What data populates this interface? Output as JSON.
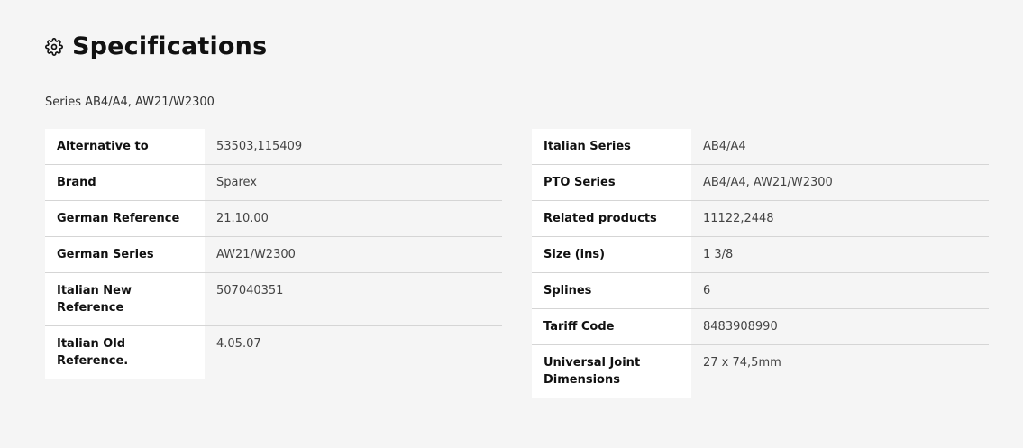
{
  "section": {
    "title": "Specifications",
    "icon": "gear-icon",
    "subtitle": "Series AB4/A4, AW21/W2300"
  },
  "left_table": [
    {
      "label": "Alternative to",
      "value": "53503,115409"
    },
    {
      "label": "Brand",
      "value": "Sparex"
    },
    {
      "label": "German Reference",
      "value": "21.10.00"
    },
    {
      "label": "German Series",
      "value": "AW21/W2300"
    },
    {
      "label": "Italian New Reference",
      "value": "507040351"
    },
    {
      "label": "Italian Old Reference.",
      "value": "4.05.07"
    }
  ],
  "right_table": [
    {
      "label": "Italian Series",
      "value": "AB4/A4"
    },
    {
      "label": "PTO Series",
      "value": "AB4/A4, AW21/W2300"
    },
    {
      "label": "Related products",
      "value": "11122,2448"
    },
    {
      "label": "Size (ins)",
      "value": "1 3/8"
    },
    {
      "label": "Splines",
      "value": "6"
    },
    {
      "label": "Tariff Code",
      "value": "8483908990"
    },
    {
      "label": "Universal Joint Dimensions",
      "value": "27 x 74,5mm"
    }
  ]
}
